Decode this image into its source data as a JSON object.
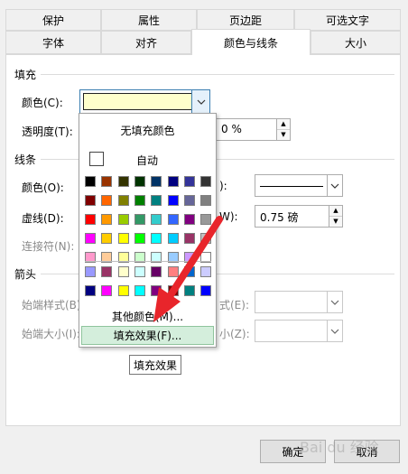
{
  "tabs_row1": [
    {
      "label": "保护"
    },
    {
      "label": "属性"
    },
    {
      "label": "页边距"
    },
    {
      "label": "可选文字"
    }
  ],
  "tabs_row2": [
    {
      "label": "字体"
    },
    {
      "label": "对齐"
    },
    {
      "label": "颜色与线条"
    },
    {
      "label": "大小"
    }
  ],
  "fill": {
    "section": "填充",
    "color_label": "颜色(C):",
    "transparency_label": "透明度(T):",
    "transparency_value": "0 %"
  },
  "line": {
    "section": "线条",
    "color_label": "颜色(O):",
    "dash_label": "虚线(D):",
    "connector_label": "连接符(N):",
    "style_label_suffix": "):",
    "weight_label_suffix": "W):",
    "weight_value": "0.75 磅"
  },
  "arrows": {
    "section": "箭头",
    "begin_style": "始端样式(B)",
    "begin_size": "始端大小(I):",
    "end_style_suffix": "式(E):",
    "end_size_suffix": "小(Z):"
  },
  "popup": {
    "no_fill": "无填充颜色",
    "auto": "自动",
    "more_colors": "其他颜色(M)...",
    "fill_effects": "填充效果(F)...",
    "tooltip": "填充效果"
  },
  "swatches_main": [
    [
      "#000000",
      "#993300",
      "#333300",
      "#003300",
      "#003366",
      "#000080",
      "#333399",
      "#333333"
    ],
    [
      "#800000",
      "#ff6600",
      "#808000",
      "#008000",
      "#008080",
      "#0000ff",
      "#666699",
      "#808080"
    ],
    [
      "#ff0000",
      "#ff9900",
      "#99cc00",
      "#339966",
      "#33cccc",
      "#3366ff",
      "#800080",
      "#999999"
    ],
    [
      "#ff00ff",
      "#ffcc00",
      "#ffff00",
      "#00ff00",
      "#00ffff",
      "#00ccff",
      "#993366",
      "#c0c0c0"
    ],
    [
      "#ff99cc",
      "#ffcc99",
      "#ffff99",
      "#ccffcc",
      "#ccffff",
      "#99ccff",
      "#cc99ff",
      "#ffffff"
    ]
  ],
  "swatches_extra": [
    [
      "#9999ff",
      "#993366",
      "#ffffcc",
      "#ccffff",
      "#660066",
      "#ff8080",
      "#0066cc",
      "#ccccff"
    ],
    [
      "#000080",
      "#ff00ff",
      "#ffff00",
      "#00ffff",
      "#800080",
      "#800000",
      "#008080",
      "#0000ff"
    ]
  ],
  "buttons": {
    "ok": "确定",
    "cancel": "取消"
  },
  "watermark": "Bai du 经验"
}
